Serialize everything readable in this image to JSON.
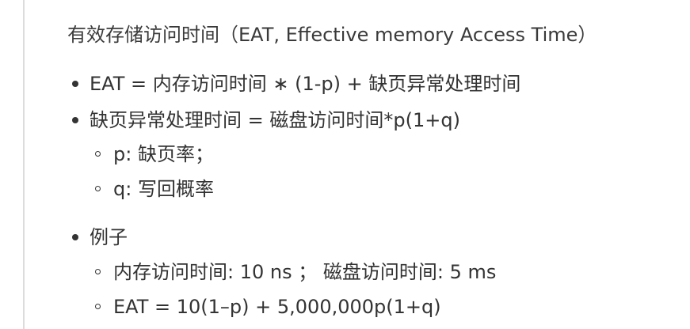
{
  "heading": "有效存储访问时间（EAT, Effective memory Access Time）",
  "list": [
    {
      "text": "EAT = 内存访问时间 ∗ (1-p) + 缺页异常处理时间"
    },
    {
      "text": "缺页异常处理时间 = 磁盘访问时间*p(1+q)",
      "sub": [
        "p: 缺页率；",
        "q: 写回概率"
      ]
    },
    {
      "text": "例子",
      "sub": [
        "内存访问时间: 10 ns ； 磁盘访问时间: 5 ms",
        "EAT = 10(1–p) + 5,000,000p(1+q)"
      ]
    }
  ]
}
